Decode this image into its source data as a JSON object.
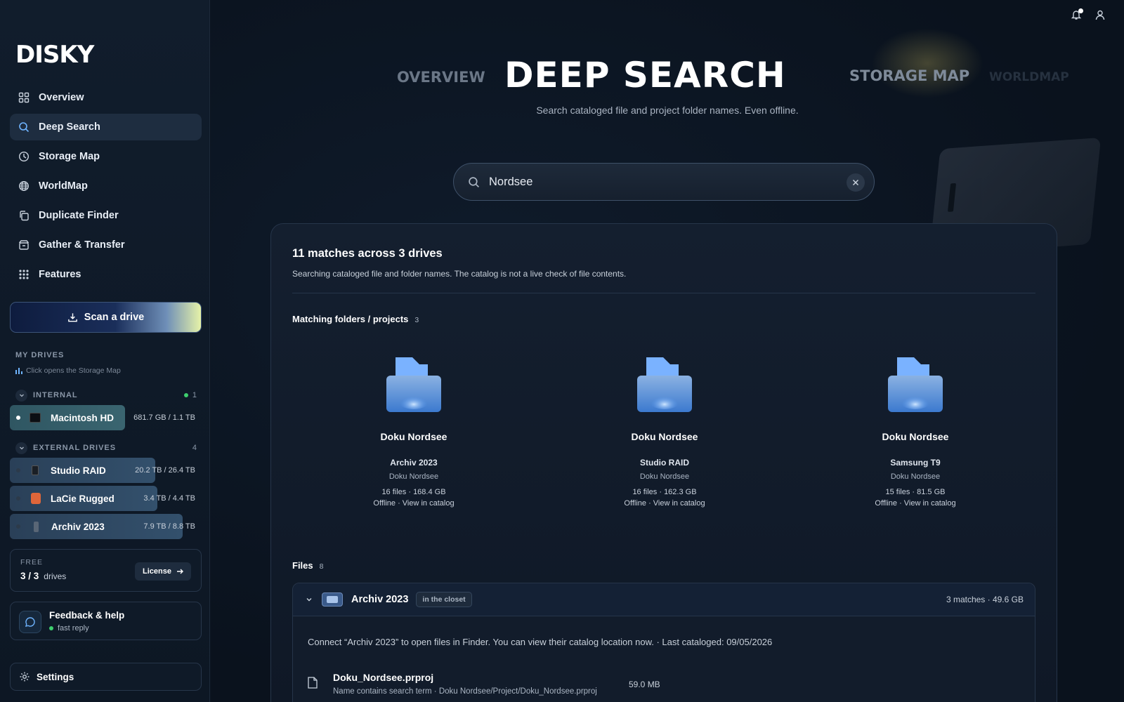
{
  "app": {
    "logo": "DISKY"
  },
  "sidebar": {
    "nav": [
      {
        "label": "Overview",
        "icon": "grid-icon"
      },
      {
        "label": "Deep Search",
        "icon": "search-icon",
        "active": true
      },
      {
        "label": "Storage Map",
        "icon": "clock-icon"
      },
      {
        "label": "WorldMap",
        "icon": "globe-icon"
      },
      {
        "label": "Duplicate Finder",
        "icon": "copy-icon"
      },
      {
        "label": "Gather & Transfer",
        "icon": "box-icon"
      },
      {
        "label": "Features",
        "icon": "apps-icon"
      }
    ],
    "scan_label": "Scan a drive",
    "my_drives_label": "MY DRIVES",
    "hint": "Click opens the Storage Map",
    "internal": {
      "label": "INTERNAL",
      "count": "1",
      "drives": [
        {
          "name": "Macintosh HD",
          "size": "681.7 GB / 1.1 TB",
          "fill": 0.6
        }
      ]
    },
    "external": {
      "label": "EXTERNAL DRIVES",
      "count": "4",
      "drives": [
        {
          "name": "Studio RAID",
          "size": "20.2 TB / 26.4 TB",
          "fill": 0.76
        },
        {
          "name": "LaCie Rugged",
          "size": "3.4 TB / 4.4 TB",
          "fill": 0.77
        },
        {
          "name": "Archiv 2023",
          "size": "7.9 TB / 8.8 TB",
          "fill": 0.9
        }
      ]
    },
    "plan": {
      "label": "FREE",
      "value": "3 / 3",
      "unit": "drives",
      "license_label": "License"
    },
    "feedback": {
      "title": "Feedback & help",
      "status": "fast reply"
    },
    "settings_label": "Settings"
  },
  "tabs": {
    "overview": "OVERVIEW",
    "deep_search": "DEEP SEARCH",
    "storage_map": "STORAGE MAP",
    "worldmap": "WORLDMAP"
  },
  "subtitle": "Search cataloged file and project folder names. Even offline.",
  "search": {
    "query": "Nordsee"
  },
  "results": {
    "title": "11 matches across 3 drives",
    "subtitle": "Searching cataloged file and folder names. The catalog is not a live check of file contents.",
    "folders_label": "Matching folders / projects",
    "folders_count": "3",
    "folders": [
      {
        "name": "Doku Nordsee",
        "drive": "Archiv 2023",
        "path": "Doku Nordsee",
        "meta": "16 files · 168.4 GB",
        "status": "Offline · View in catalog"
      },
      {
        "name": "Doku Nordsee",
        "drive": "Studio RAID",
        "path": "Doku Nordsee",
        "meta": "16 files · 162.3 GB",
        "status": "Offline · View in catalog"
      },
      {
        "name": "Doku Nordsee",
        "drive": "Samsung T9",
        "path": "Doku Nordsee",
        "meta": "15 files · 81.5 GB",
        "status": "Offline · View in catalog"
      }
    ],
    "files_label": "Files",
    "files_count": "8",
    "group": {
      "drive": "Archiv 2023",
      "tag": "in the closet",
      "summary": "3 matches · 49.6 GB",
      "note": "Connect “Archiv 2023” to open files in Finder. You can view their catalog location now. · Last cataloged: 09/05/2026",
      "files": [
        {
          "name": "Doku_Nordsee.prproj",
          "path": "Name contains search term · Doku Nordsee/Project/Doku_Nordsee.prproj",
          "size": "59.0 MB"
        }
      ]
    }
  }
}
